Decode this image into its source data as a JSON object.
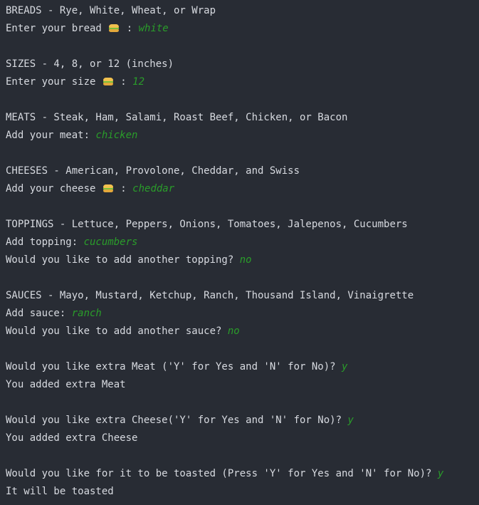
{
  "lines": {
    "breads_header": "BREADS - Rye, White, Wheat, or Wrap",
    "bread_prompt": "Enter your bread ",
    "bread_prompt_suffix": " : ",
    "bread_input": "white",
    "sizes_header": "SIZES - 4, 8, or 12 (inches)",
    "size_prompt": "Enter your size ",
    "size_prompt_suffix": " : ",
    "size_input": "12",
    "meats_header": "MEATS - Steak, Ham, Salami, Roast Beef, Chicken, or Bacon",
    "meat_prompt": "Add your meat: ",
    "meat_input": "chicken",
    "cheeses_header": "CHEESES - American, Provolone, Cheddar, and Swiss",
    "cheese_prompt": "Add your cheese ",
    "cheese_prompt_suffix": " : ",
    "cheese_input": "cheddar",
    "toppings_header": "TOPPINGS - Lettuce, Peppers, Onions, Tomatoes, Jalepenos, Cucumbers",
    "topping_prompt": "Add topping: ",
    "topping_input": "cucumbers",
    "another_topping_prompt": "Would you like to add another topping? ",
    "another_topping_input": "no",
    "sauces_header": "SAUCES - Mayo, Mustard, Ketchup, Ranch, Thousand Island, Vinaigrette",
    "sauce_prompt": "Add sauce: ",
    "sauce_input": "ranch",
    "another_sauce_prompt": "Would you like to add another sauce? ",
    "another_sauce_input": "no",
    "extra_meat_prompt": "Would you like extra Meat ('Y' for Yes and 'N' for No)? ",
    "extra_meat_input": "y",
    "extra_meat_result": "You added extra Meat",
    "extra_cheese_prompt": "Would you like extra Cheese('Y' for Yes and 'N' for No)? ",
    "extra_cheese_input": "y",
    "extra_cheese_result": "You added extra Cheese",
    "toasted_prompt": "Would you like for it to be toasted (Press 'Y' for Yes and 'N' for No)? ",
    "toasted_input": "y",
    "toasted_result": "It will be toasted"
  },
  "icons": {
    "sandwich": "sandwich-emoji"
  },
  "colors": {
    "background": "#282c34",
    "text": "#d7dae0",
    "user_input": "#2a9d2a"
  }
}
